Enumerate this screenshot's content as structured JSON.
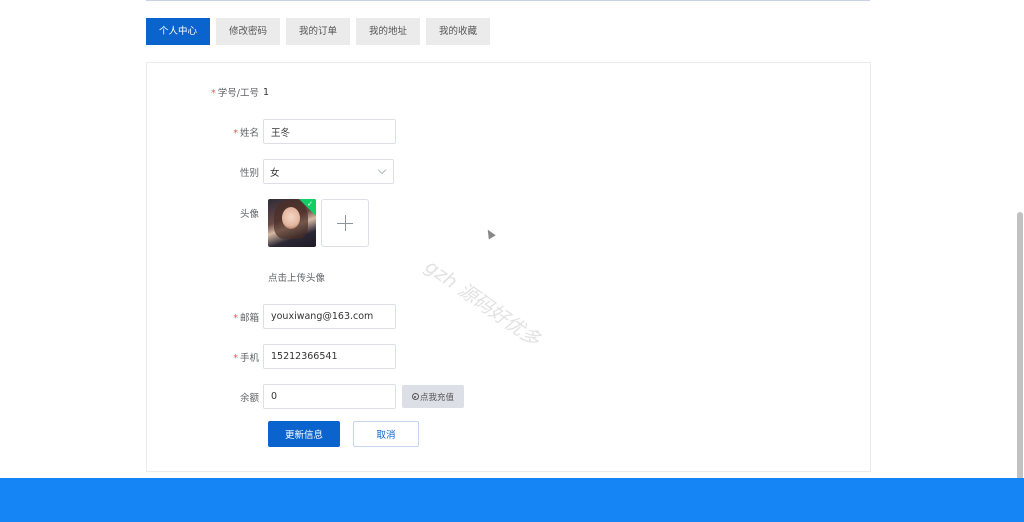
{
  "tabs": [
    {
      "label": "个人中心",
      "active": true
    },
    {
      "label": "修改密码",
      "active": false
    },
    {
      "label": "我的订单",
      "active": false
    },
    {
      "label": "我的地址",
      "active": false
    },
    {
      "label": "我的收藏",
      "active": false
    }
  ],
  "form": {
    "student_id": {
      "label": "学号/工号",
      "value": "1",
      "required": true
    },
    "name": {
      "label": "姓名",
      "value": "王冬",
      "required": true
    },
    "gender": {
      "label": "性别",
      "value": "女"
    },
    "avatar": {
      "label": "头像",
      "upload_hint": "点击上传头像"
    },
    "email": {
      "label": "邮箱",
      "value": "youxiwang@163.com",
      "required": true
    },
    "phone": {
      "label": "手机",
      "value": "15212366541",
      "required": true
    },
    "balance": {
      "label": "余额",
      "value": "0",
      "recharge_label": "点我充值"
    }
  },
  "buttons": {
    "update": "更新信息",
    "cancel": "取消"
  },
  "watermark": "gzh 源码好优多",
  "colors": {
    "primary": "#0b63ce",
    "footer": "#1585f5",
    "required_star": "#e05a5a"
  }
}
